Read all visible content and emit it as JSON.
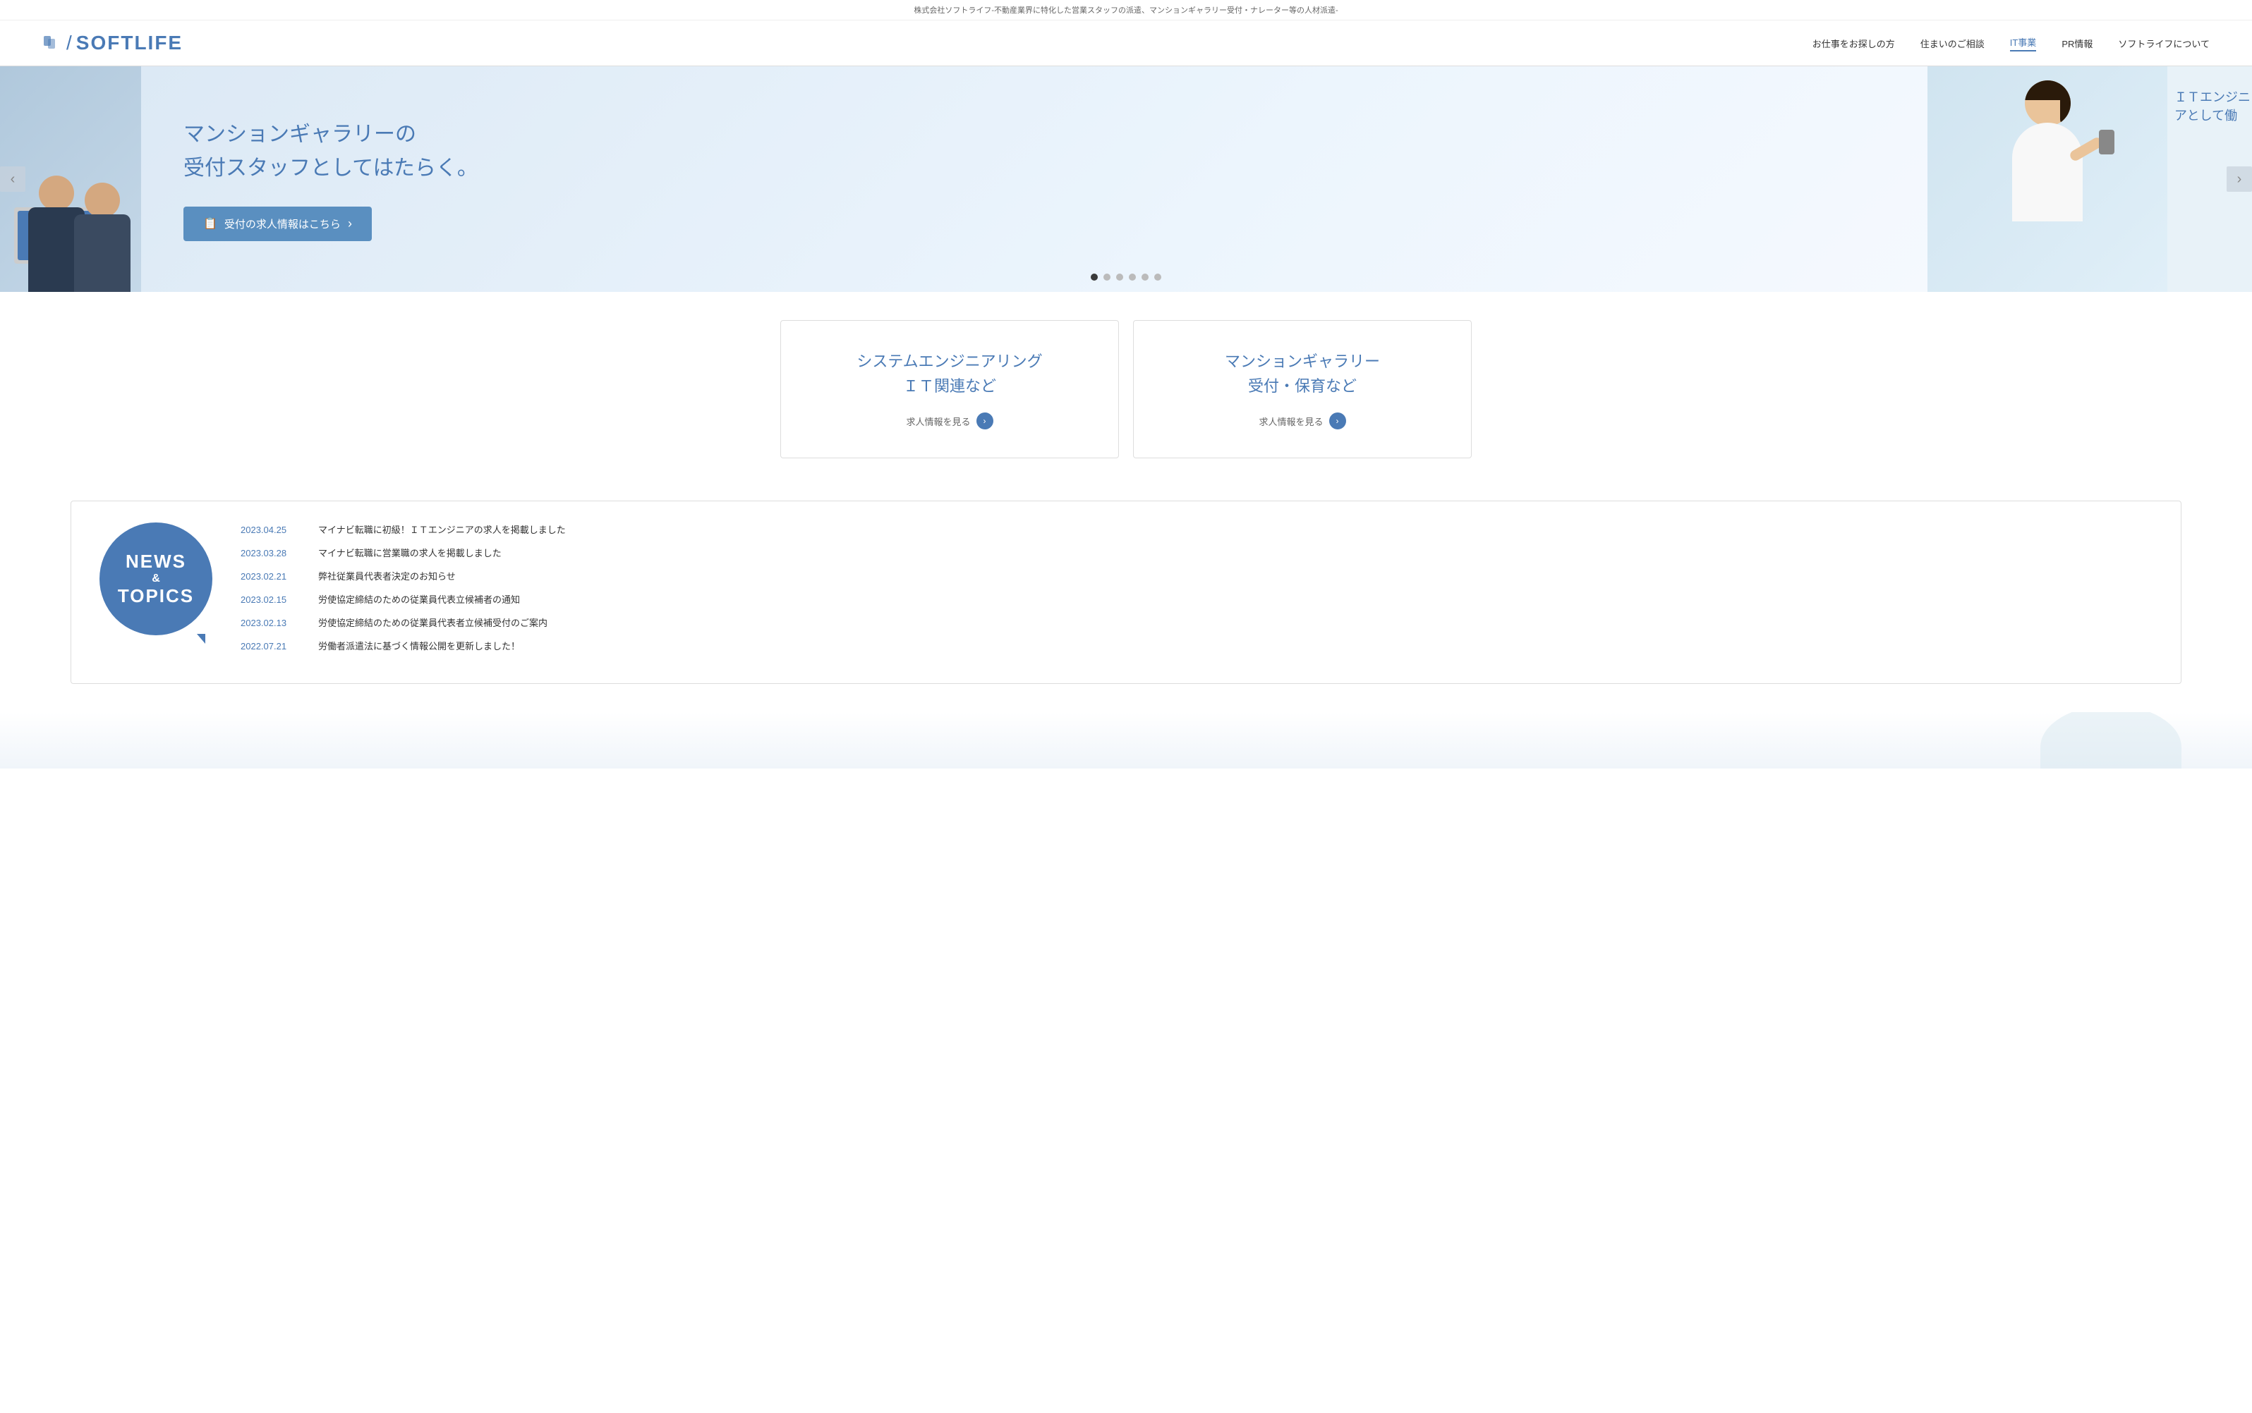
{
  "topbar": {
    "text": "株式会社ソフトライフ-不動産業界に特化した営業スタッフの派遣、マンションギャラリー受付・ナレーター等の人材派遣-"
  },
  "header": {
    "logo_text": "SOFTLIFE",
    "nav": [
      {
        "id": "find-job",
        "label": "お仕事をお探しの方"
      },
      {
        "id": "housing",
        "label": "住まいのご相談"
      },
      {
        "id": "it",
        "label": "IT事業",
        "active": true
      },
      {
        "id": "pr",
        "label": "PR情報"
      },
      {
        "id": "about",
        "label": "ソフトライフについて"
      }
    ]
  },
  "slider": {
    "prev_label": "‹",
    "next_label": "›",
    "main_title_line1": "マンションギャラリーの",
    "main_title_line2": "受付スタッフとしてはたらく。",
    "cta_button": "受付の求人情報はこちら",
    "right_text": "ＩＴエンジニアとして働",
    "dots": [
      {
        "active": true
      },
      {
        "active": false
      },
      {
        "active": false
      },
      {
        "active": false
      },
      {
        "active": false
      },
      {
        "active": false
      }
    ]
  },
  "job_cards": [
    {
      "id": "it-card",
      "title_line1": "システムエンジニアリング",
      "title_line2": "ＩＴ関連など",
      "link_text": "求人情報を見る"
    },
    {
      "id": "mansion-card",
      "title_line1": "マンションギャラリー",
      "title_line2": "受付・保育など",
      "link_text": "求人情報を見る"
    }
  ],
  "news": {
    "badge_line1": "NEWS",
    "badge_line2": "&",
    "badge_line3": "TOPICS",
    "items": [
      {
        "date": "2023.04.25",
        "text": "マイナビ転職に初級！ＩＴエンジニアの求人を掲載しました"
      },
      {
        "date": "2023.03.28",
        "text": "マイナビ転職に営業職の求人を掲載しました"
      },
      {
        "date": "2023.02.21",
        "text": "弊社従業員代表者決定のお知らせ"
      },
      {
        "date": "2023.02.15",
        "text": "労使協定締結のための従業員代表立候補者の通知"
      },
      {
        "date": "2023.02.13",
        "text": "労使協定締結のための従業員代表者立候補受付のご案内"
      },
      {
        "date": "2022.07.21",
        "text": "労働者派遣法に基づく情報公開を更新しました！"
      }
    ]
  }
}
